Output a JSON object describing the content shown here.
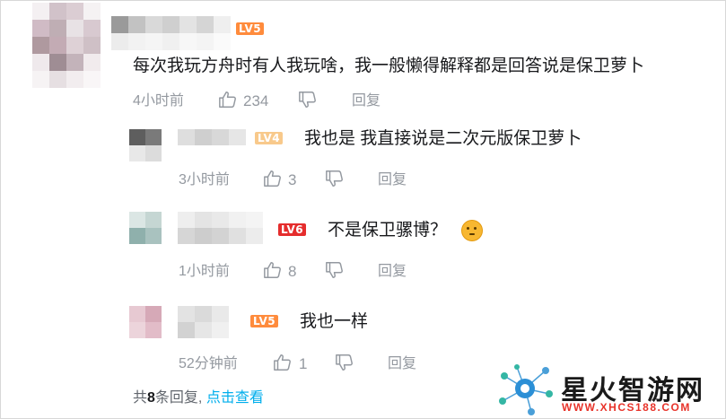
{
  "comment": {
    "level_badge": "LV5",
    "text": "每次我玩方舟时有人我玩啥，我一般懒得解释都是回答说是保卫萝卜",
    "time": "4小时前",
    "like_count": "234",
    "reply_label": "回复"
  },
  "replies": [
    {
      "level_badge": "LV4",
      "text": "我也是 我直接说是二次元版保卫萝卜",
      "time": "3小时前",
      "like_count": "3",
      "reply_label": "回复"
    },
    {
      "level_badge": "LV6",
      "text": "不是保卫骡博？",
      "time": "1小时前",
      "like_count": "8",
      "reply_label": "回复",
      "emoji": "thinking-face-emoji"
    },
    {
      "level_badge": "LV5",
      "text": "我也一样",
      "time": "52分钟前",
      "like_count": "1",
      "reply_label": "回复"
    }
  ],
  "footer": {
    "total_prefix": "共",
    "total_count": "8",
    "total_suffix": "条回复,",
    "view_more": "点击查看"
  },
  "watermark": {
    "site_name": "星火智游网",
    "url": "WWW.XHCS188.COM"
  },
  "colors": {
    "lv4": "#f8c98b",
    "lv5": "#ff8b3c",
    "lv6": "#e52d2d",
    "link": "#00aeec",
    "meta": "#9499a0"
  },
  "icons": [
    "thumbs-up-icon",
    "thumbs-down-icon",
    "thinking-face-emoji",
    "watermark-logo-icon"
  ]
}
